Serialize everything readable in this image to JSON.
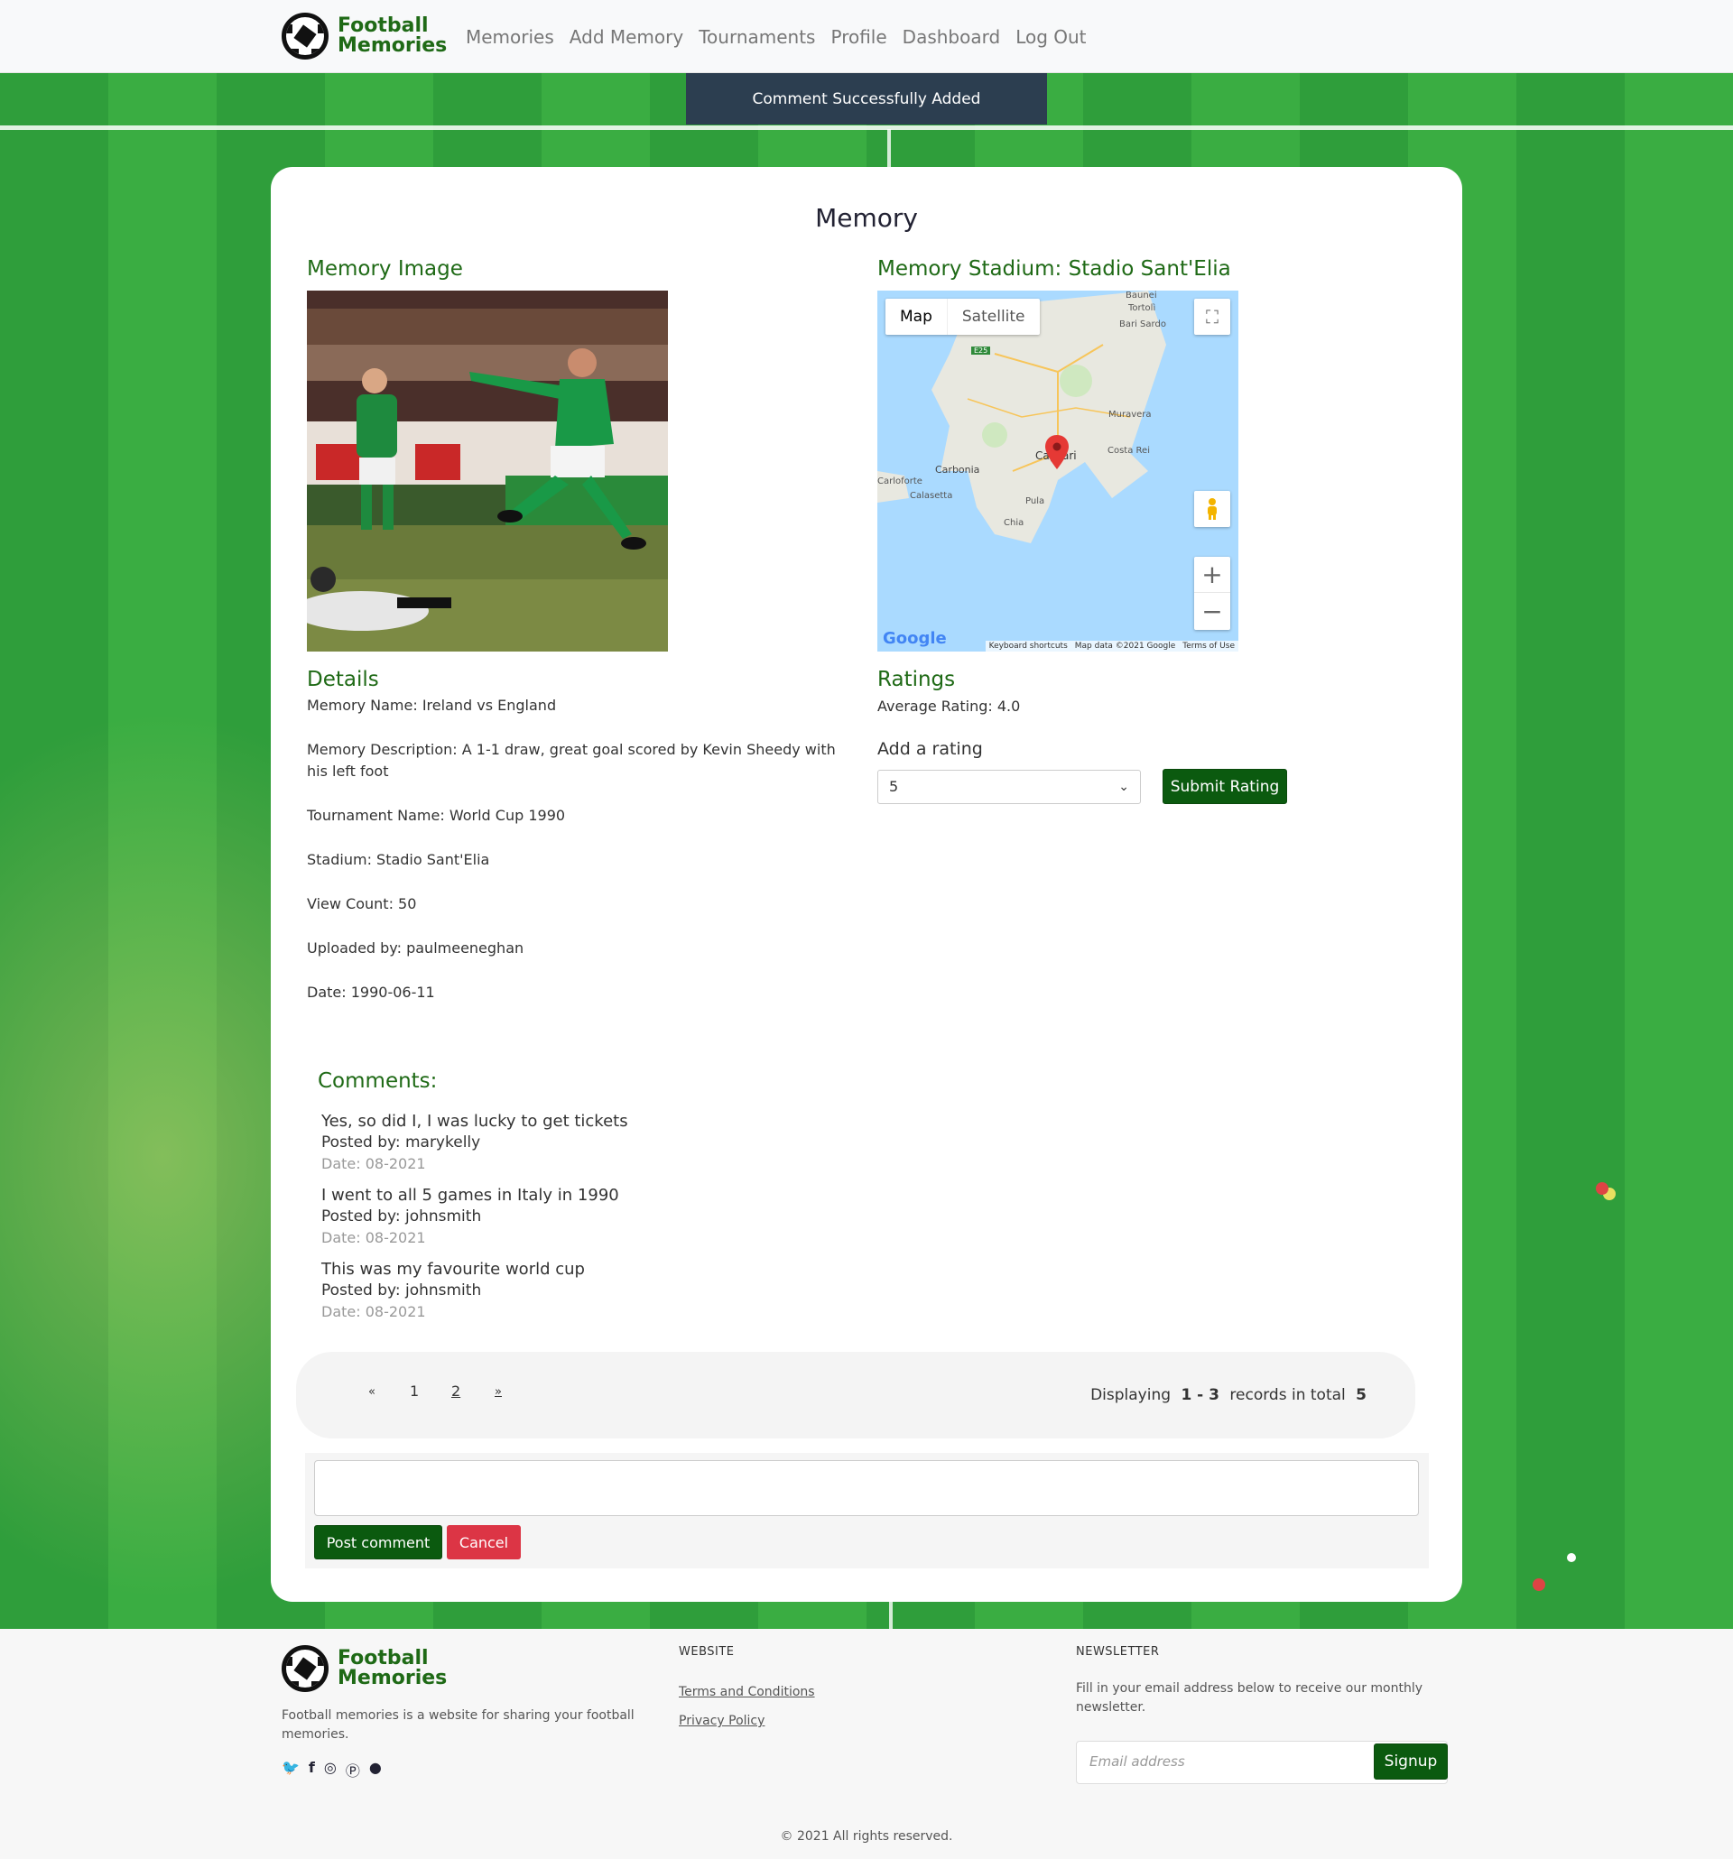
{
  "nav": {
    "brand_line1": "Football",
    "brand_line2": "Memories",
    "items": [
      "Memories",
      "Add Memory",
      "Tournaments",
      "Profile",
      "Dashboard",
      "Log Out"
    ]
  },
  "toast": "Comment Successfully Added",
  "memory": {
    "title": "Memory",
    "image_heading": "Memory Image",
    "stadium_heading": "Memory Stadium: Stadio Sant'Elia",
    "map": {
      "tab_map": "Map",
      "tab_satellite": "Satellite",
      "places": [
        "Tortolì",
        "Bari Sardo",
        "Muravera",
        "Costa Rei",
        "Carbonia",
        "Carloforte",
        "Calasetta",
        "Cagliari",
        "Pula",
        "Chia",
        "Baunei"
      ],
      "road_label": "E25",
      "google": "Google",
      "footer_shortcuts": "Keyboard shortcuts",
      "footer_data": "Map data ©2021 Google",
      "footer_terms": "Terms of Use"
    },
    "details_heading": "Details",
    "details": [
      "Memory Name: Ireland vs England",
      "Memory Description: A 1-1 draw, great goal scored by Kevin Sheedy with his left foot",
      "Tournament Name: World Cup 1990",
      "Stadium: Stadio Sant'Elia",
      "View Count: 50",
      "Uploaded by: paulmeeneghan",
      "Date: 1990-06-11"
    ],
    "ratings_heading": "Ratings",
    "average_rating": "Average Rating: 4.0",
    "add_rating_label": "Add a rating",
    "rating_selected": "5",
    "submit_rating": "Submit Rating"
  },
  "comments": {
    "heading": "Comments:",
    "items": [
      {
        "text": "Yes, so did I, I was lucky to get tickets",
        "by": "Posted by: marykelly",
        "date": "Date: 08-2021"
      },
      {
        "text": "I went to all 5 games in Italy in 1990",
        "by": "Posted by: johnsmith",
        "date": "Date: 08-2021"
      },
      {
        "text": "This was my favourite world cup",
        "by": "Posted by: johnsmith",
        "date": "Date: 08-2021"
      }
    ],
    "pagination": {
      "prev": "«",
      "pages": [
        "1",
        "2"
      ],
      "next": "»",
      "displaying": "Displaying",
      "range": "1 - 3",
      "records_in_total": "records in total",
      "total": "5"
    },
    "post_button": "Post comment",
    "cancel_button": "Cancel"
  },
  "footer": {
    "brand_line1": "Football",
    "brand_line2": "Memories",
    "about": "Football memories is a website for sharing your football memories.",
    "social_icons": [
      "twitter-icon",
      "facebook-icon",
      "instagram-icon",
      "pinterest-icon",
      "snapchat-icon"
    ],
    "website_heading": "WEBSITE",
    "links": [
      "Terms and Conditions",
      "Privacy Policy"
    ],
    "newsletter_heading": "NEWSLETTER",
    "newsletter_text": "Fill in your email address below to receive our monthly newsletter.",
    "email_placeholder": "Email address",
    "signup": "Signup",
    "copyright": "© 2021 All rights reserved."
  },
  "colors": {
    "brand_green": "#1f6a16",
    "button_green": "#0b5a0f",
    "cancel_red": "#dc3545",
    "toast_bg": "#2c3e50"
  }
}
